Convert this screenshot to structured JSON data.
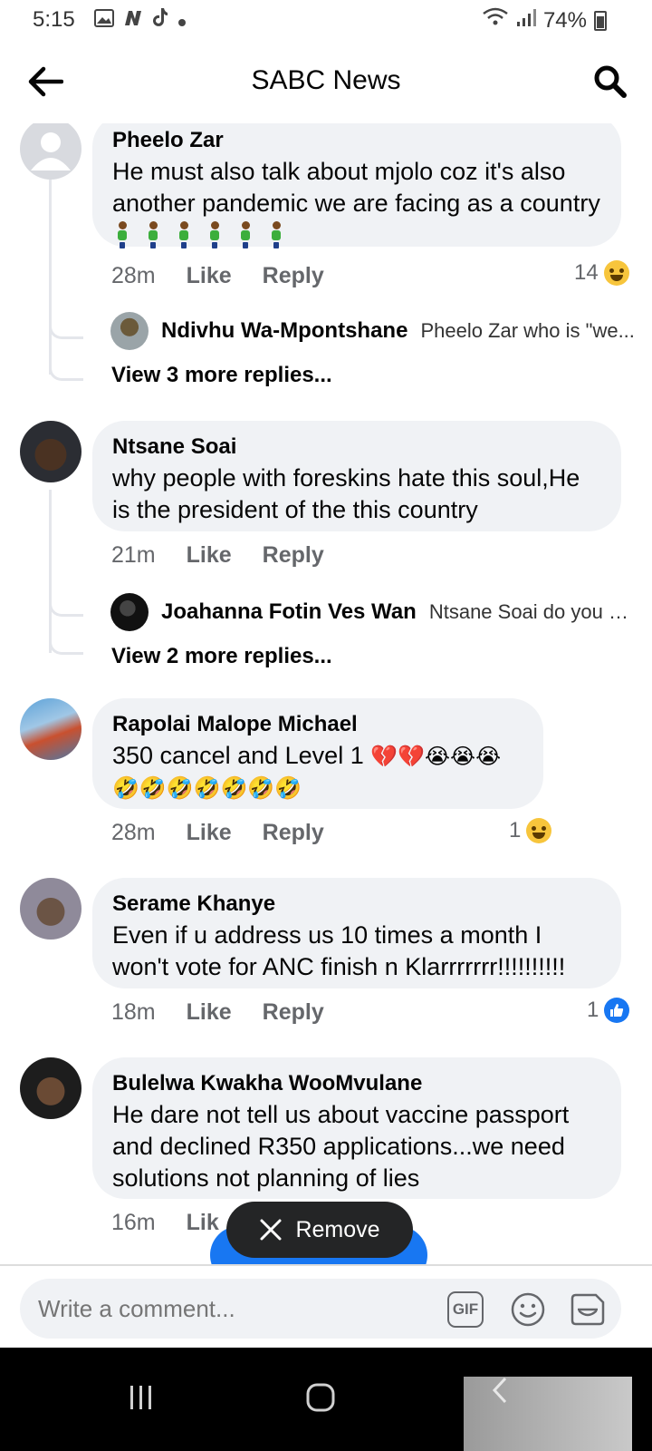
{
  "status_bar": {
    "time": "5:15",
    "battery": "74%"
  },
  "header": {
    "title": "SABC News"
  },
  "comments": [
    {
      "author": "Pheelo Zar",
      "text": "He must also talk about mjolo coz it's also another pandemic we are facing as a country",
      "time": "28m",
      "like_label": "Like",
      "reply_label": "Reply",
      "reaction_count": "14",
      "reaction_type": "haha",
      "reply_preview": {
        "author": "Ndivhu Wa-Mpontshane",
        "snippet": "Pheelo Zar who is \"we..."
      },
      "more_replies": "View 3 more replies..."
    },
    {
      "author": "Ntsane Soai",
      "text": "why people with foreskins hate this soul,He is the president of the this country",
      "time": "21m",
      "like_label": "Like",
      "reply_label": "Reply",
      "reply_preview": {
        "author": "Joahanna Fotin Ves Wan",
        "snippet": "Ntsane Soai do you g..."
      },
      "more_replies": "View 2 more replies..."
    },
    {
      "author": "Rapolai Malope Michael",
      "text": "350 cancel and Level 1",
      "emojis_line1": "💔💔😭😭😭",
      "emojis_line2": "🤣🤣🤣🤣🤣🤣🤣",
      "time": "28m",
      "like_label": "Like",
      "reply_label": "Reply",
      "reaction_count": "1",
      "reaction_type": "haha"
    },
    {
      "author": "Serame Khanye",
      "text": "Even if u address us 10 times a month I won't vote for  ANC finish n Klarrrrrrr!!!!!!!!!!",
      "time": "18m",
      "like_label": "Like",
      "reply_label": "Reply",
      "reaction_count": "1",
      "reaction_type": "like"
    },
    {
      "author": "Bulelwa Kwakha WooMvulane",
      "text": "He dare not tell us about vaccine passport and declined R350 applications...we need solutions not planning of lies",
      "time": "16m",
      "like_label": "Lik"
    }
  ],
  "remove_toast": {
    "label": "Remove"
  },
  "composer": {
    "placeholder": "Write a comment...",
    "gif_label": "GIF"
  },
  "colors": {
    "accent": "#1877f2",
    "bubble": "#f0f2f5",
    "muted_text": "#65676b"
  }
}
